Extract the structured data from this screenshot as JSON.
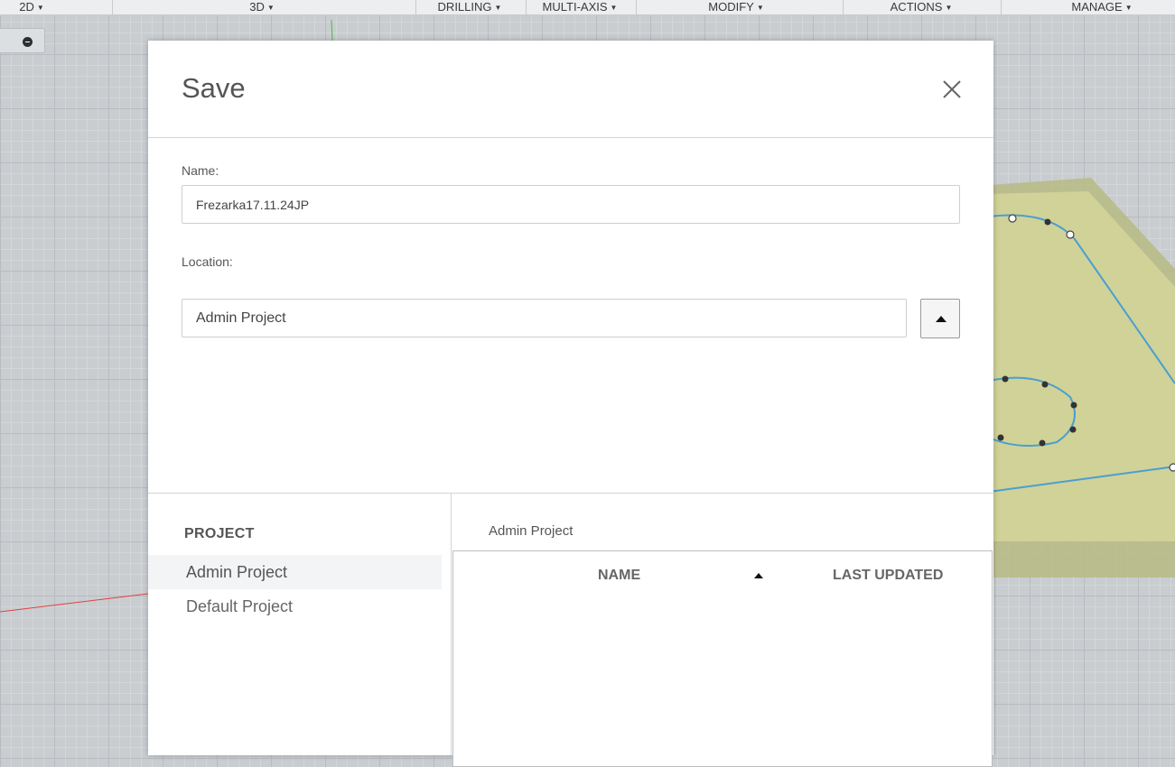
{
  "toolbar": {
    "items": [
      {
        "label": "2D"
      },
      {
        "label": "3D"
      },
      {
        "label": "DRILLING"
      },
      {
        "label": "MULTI-AXIS"
      },
      {
        "label": "MODIFY"
      },
      {
        "label": "ACTIONS"
      },
      {
        "label": "MANAGE"
      }
    ]
  },
  "dialog": {
    "title": "Save",
    "name_label": "Name:",
    "name_value": "Frezarka17.11.24JP",
    "location_label": "Location:",
    "location_value": "Admin Project",
    "project_heading": "PROJECT",
    "projects": [
      {
        "label": "Admin Project",
        "selected": true
      },
      {
        "label": "Default Project",
        "selected": false
      }
    ],
    "breadcrumb": "Admin Project",
    "table": {
      "col_name": "NAME",
      "col_updated": "LAST UPDATED",
      "sort": "ascending"
    }
  },
  "colors": {
    "sketch_line": "#4a9fd0",
    "stock_fill": "#c9cf8a",
    "x_axis": "#e04040",
    "y_axis": "#3fbf3f"
  },
  "icons": [
    "close-icon",
    "collapse-caret-icon",
    "sort-ascending-icon",
    "dropdown-caret-icon",
    "view-home-icon"
  ]
}
